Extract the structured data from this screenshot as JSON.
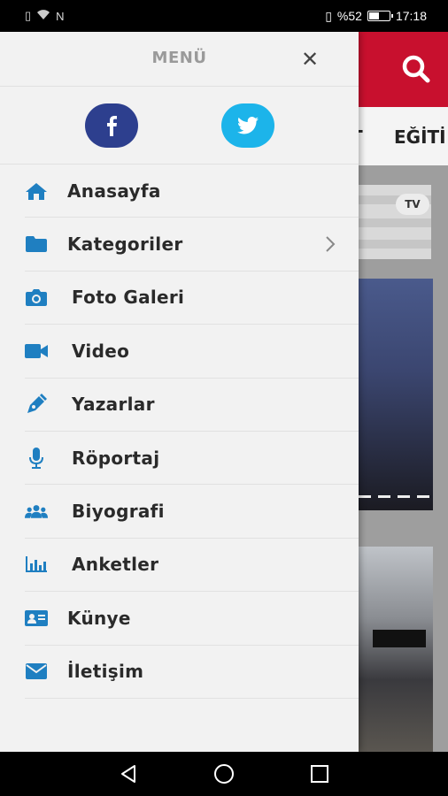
{
  "status_bar": {
    "battery": "%52",
    "time": "17:18",
    "battery_level": 0.52
  },
  "app": {
    "nav_items": [
      "T",
      "EĞİTİ"
    ],
    "card_logo": "TV"
  },
  "drawer": {
    "title": "MENÜ",
    "close_icon": "close-icon",
    "social": [
      {
        "name": "facebook",
        "icon": "facebook-icon",
        "color": "#2d3f8e"
      },
      {
        "name": "twitter",
        "icon": "twitter-icon",
        "color": "#1cb4ea"
      }
    ],
    "items": [
      {
        "label": "Anasayfa",
        "icon": "home-icon"
      },
      {
        "label": "Kategoriler",
        "icon": "folder-icon",
        "has_submenu": true
      },
      {
        "label": "Foto Galeri",
        "icon": "camera-icon"
      },
      {
        "label": "Video",
        "icon": "video-camera-icon"
      },
      {
        "label": "Yazarlar",
        "icon": "pen-icon"
      },
      {
        "label": "Röportaj",
        "icon": "microphone-icon"
      },
      {
        "label": "Biyografi",
        "icon": "users-icon"
      },
      {
        "label": "Anketler",
        "icon": "bar-chart-icon"
      },
      {
        "label": "Künye",
        "icon": "id-card-icon"
      },
      {
        "label": "İletişim",
        "icon": "envelope-icon"
      }
    ],
    "accent_color": "#1f7fc1"
  },
  "header_color": "#c8102e"
}
